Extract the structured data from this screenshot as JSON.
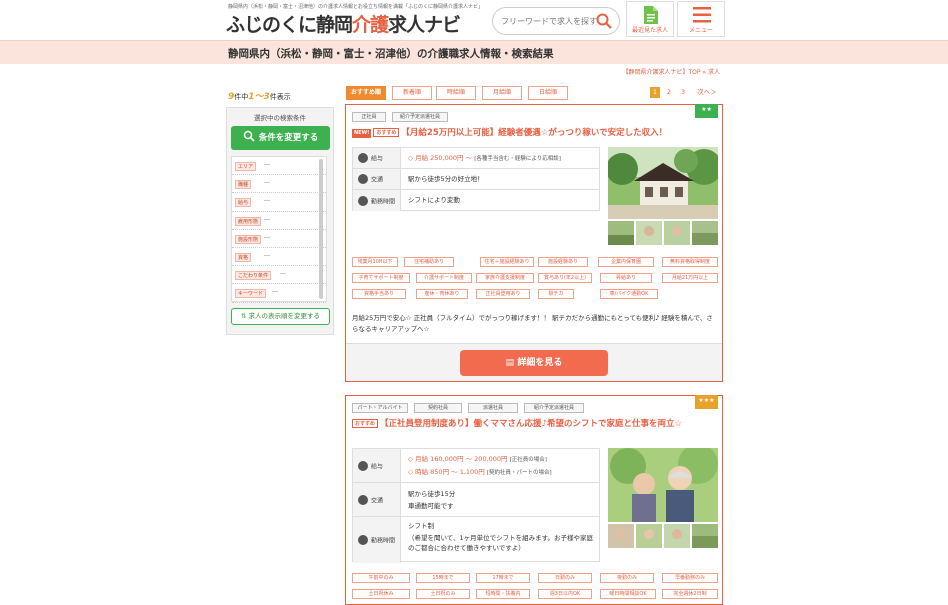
{
  "header": {
    "tagline": "静岡県内（浜松・静岡・富士・沼津他）の介護求人情報とお役立ち情報を満載「ふじのくに静岡県介護求人ナビ」",
    "logo_pre": "ふじのくに静岡",
    "logo_accent": "介護",
    "logo_post": "求人ナビ",
    "search_placeholder": "フリーワードで求人を探す",
    "recent_label": "最近見た求人",
    "menu_label": "メニュー"
  },
  "page_title": "静岡県内（浜松・静岡・富士・沼津他）の介護職求人情報・検索結果",
  "breadcrumb": "【静岡県介護求人ナビ】TOP » 求人",
  "result": {
    "total": "9",
    "mid1": "件中",
    "range": "1〜3",
    "mid2": "件表示"
  },
  "sidebar": {
    "title": "選択中の検索条件",
    "change_button": "条件を変更する",
    "conditions": [
      {
        "key": "エリア",
        "value": "---"
      },
      {
        "key": "職種",
        "value": "---"
      },
      {
        "key": "給与",
        "value": "---"
      },
      {
        "key": "雇用形態",
        "value": "---"
      },
      {
        "key": "施設形態",
        "value": "---"
      },
      {
        "key": "資格",
        "value": "---"
      },
      {
        "key": "こだわり条件",
        "value": "---"
      },
      {
        "key": "キーワード",
        "value": "---"
      }
    ],
    "sort_button": "求人の表示順を変更する"
  },
  "sort_tabs": [
    "おすすめ順",
    "新着順",
    "時給順",
    "月給順",
    "日給順"
  ],
  "pager": {
    "pages": [
      "1",
      "2",
      "3"
    ],
    "next": "次へ＞"
  },
  "jobs": [
    {
      "stars": "★★",
      "tags": [
        "正社員",
        "紹介予定派遣社員"
      ],
      "badge_new": "NEW!",
      "badge_rec": "おすすめ",
      "title": "【月給25万円以上可能】経験者優遇☆がっつり稼いで安定した収入！",
      "salary_label": "給与",
      "salary_prefix": "◇",
      "salary_head": "月給",
      "salary_amount": "250,000円 〜",
      "salary_note": "[各種手当含む・経験により応相談]",
      "access_label": "交通",
      "access": "駅から徒歩5分の好立地！",
      "hours_label": "勤務時間",
      "hours": "シフトにより変動",
      "perks": [
        "残業月10H以下",
        "住宅補助あり",
        "住宅＋施設経験あり",
        "施設経験あり",
        "企業内保育園",
        "無料資格取得制度",
        "子育てサポート制度",
        "介護サポート制度",
        "家族介護支援制度",
        "賞与あり(年2以上)",
        "昇給あり",
        "月給21万円以上",
        "資格手当あり",
        "産休・育休あり",
        "正社員登用あり",
        "駅チカ",
        "車/バイク通勤OK"
      ],
      "description": "月給25万円で安心☆ 正社員（フルタイム）でがっつり稼げます！！ 駅チカだから通勤にもとっても便利♪ 経験を積んで、さらなるキャリアアップへ☆",
      "cta": "詳細を見る"
    },
    {
      "stars": "★★★",
      "tags": [
        "パート・アルバイト",
        "契約社員",
        "派遣社員",
        "紹介予定派遣社員"
      ],
      "badge_rec": "おすすめ",
      "title": "【正社員登用制度あり】働くママさん応援♪希望のシフトで家庭と仕事を両立☆",
      "salary_label": "給与",
      "salary_prefix": "◇",
      "salary_head": "月給",
      "salary_amount": "160,000円 〜 200,000円",
      "salary_note": "[正社員の場合]",
      "salary2_prefix": "◇",
      "salary2_head": "時給",
      "salary2_amount": "850円 〜 1,100円",
      "salary2_note": "[契約社員・パートの場合]",
      "access_label": "交通",
      "access1": "駅から徒歩15分",
      "access2": "車通勤可能です",
      "hours_label": "勤務時間",
      "hours1": "シフト制",
      "hours2": "（希望を聞いて、1ヶ月単位でシフトを組みます。お子様や家庭のご都合に合わせて働きやすいですよ）",
      "perks": [
        "午前中のみ",
        "15時まで",
        "17時まで",
        "日勤のみ",
        "夜勤のみ",
        "早番勤務のみ",
        "土日祝休み",
        "土日祝のみ",
        "短時間・扶養内",
        "週3日以内OK",
        "曜日時間相談OK",
        "完全週休2日制"
      ]
    }
  ],
  "colors": {
    "accent": "#e95f42",
    "green": "#3db050",
    "orange": "#f08a2e",
    "pink_bar": "#fbe4dc"
  }
}
